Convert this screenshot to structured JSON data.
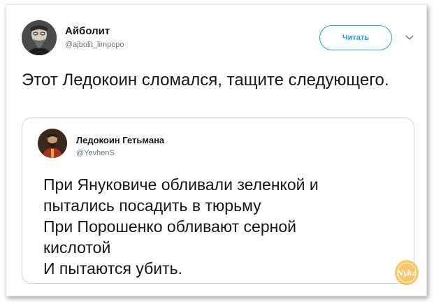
{
  "author": {
    "name": "Айболит",
    "handle": "@ajbolit_limpopo"
  },
  "follow_button": {
    "label": "Читать"
  },
  "tweet": {
    "text": "Этот Ледокоин сломался, тащите следующего."
  },
  "quoted": {
    "name": "Ледокоин Гетьмана",
    "handle": "@YevhenS",
    "lines": [
      "При Януковиче обливали зеленкой и",
      "пытались посадить в тюрьму",
      "При Порошенко обливают серной",
      "кислотой",
      "И пытаются убить."
    ]
  },
  "watermark": {
    "text": "Nyka"
  },
  "colors": {
    "accent": "#1da1f2",
    "text": "#14171a",
    "muted": "#657786",
    "border": "#ccd6dd",
    "watermark": "#f2b53a"
  }
}
